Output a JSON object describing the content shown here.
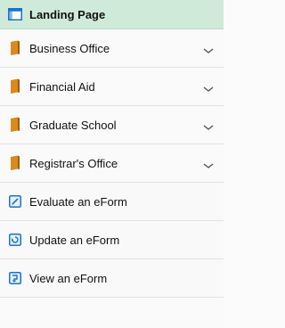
{
  "landing": {
    "label": "Landing Page",
    "icon": "page-icon"
  },
  "folders": [
    {
      "label": "Business Office",
      "icon": "folder-icon",
      "chevron": "chevron-down-icon"
    },
    {
      "label": "Financial Aid",
      "icon": "folder-icon",
      "chevron": "chevron-down-icon"
    },
    {
      "label": "Graduate School",
      "icon": "folder-icon",
      "chevron": "chevron-down-icon"
    },
    {
      "label": "Registrar's Office",
      "icon": "folder-icon",
      "chevron": "chevron-down-icon"
    }
  ],
  "actions": [
    {
      "label": "Evaluate an eForm",
      "icon": "evaluate-form-icon"
    },
    {
      "label": "Update an eForm",
      "icon": "update-form-icon"
    },
    {
      "label": "View an eForm",
      "icon": "view-form-icon"
    }
  ],
  "colors": {
    "active_bg": "#cfead9",
    "folder": "#d98a1d",
    "action_icon": "#1a73c9"
  }
}
